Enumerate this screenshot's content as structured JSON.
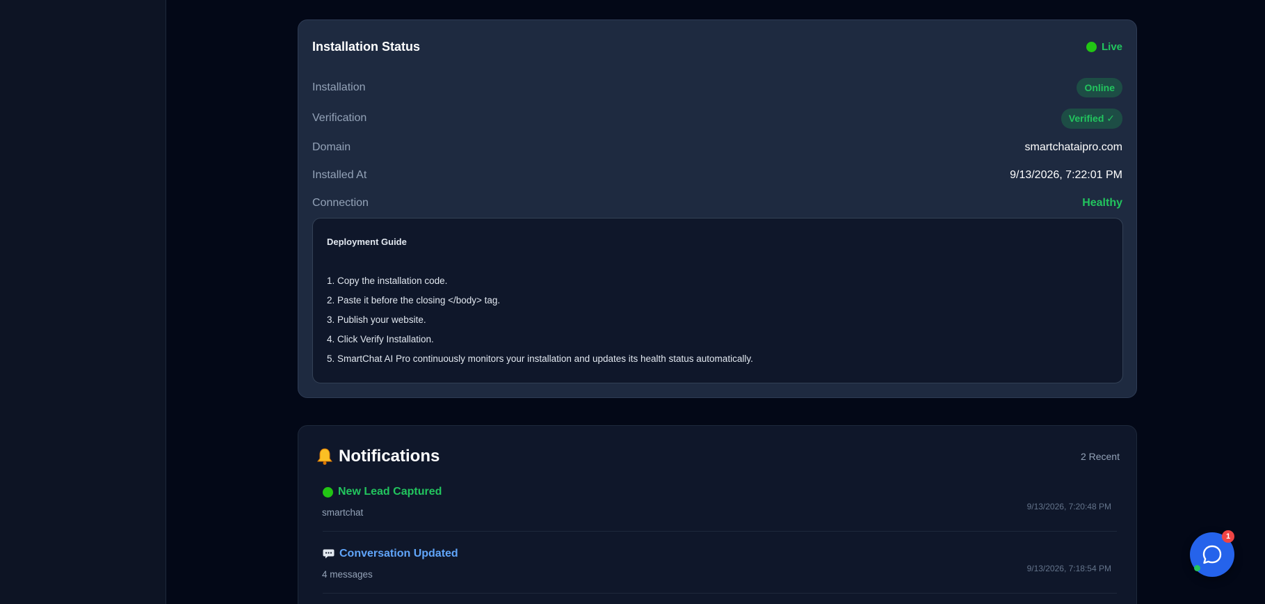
{
  "colors": {
    "background": "#030817",
    "card": "#1e2a40",
    "success": "#22c55e",
    "link_blue": "#60a5fa",
    "fab_blue": "#2563eb",
    "badge_red": "#ef4444"
  },
  "installation_status": {
    "title": "Installation Status",
    "live_label": "Live",
    "rows": [
      {
        "label": "Installation",
        "value": "Online"
      },
      {
        "label": "Verification",
        "value": "Verified ✓"
      },
      {
        "label": "Domain",
        "value": "smartchataipro.com"
      },
      {
        "label": "Installed At",
        "value": "9/13/2026, 7:22:01 PM"
      },
      {
        "label": "Connection",
        "value": "Healthy"
      }
    ]
  },
  "deployment_guide": {
    "title": "Deployment Guide",
    "steps": [
      "1. Copy the installation code.",
      "2. Paste it before the closing </body> tag.",
      "3. Publish your website.",
      "4. Click Verify Installation.",
      "5. SmartChat AI Pro continuously monitors your installation and updates its health status automatically."
    ]
  },
  "notifications": {
    "title": "Notifications",
    "count_label": "2 Recent",
    "items": [
      {
        "icon": "green-dot-icon",
        "title": "New Lead Captured",
        "subtitle": "smartchat",
        "time": "9/13/2026, 7:20:48 PM"
      },
      {
        "icon": "speech-bubble-icon",
        "title": "Conversation Updated",
        "subtitle": "4 messages",
        "time": "9/13/2026, 7:18:54 PM"
      }
    ]
  },
  "chat_widget": {
    "icon": "chat-bubble-icon",
    "badge_count": "1"
  }
}
